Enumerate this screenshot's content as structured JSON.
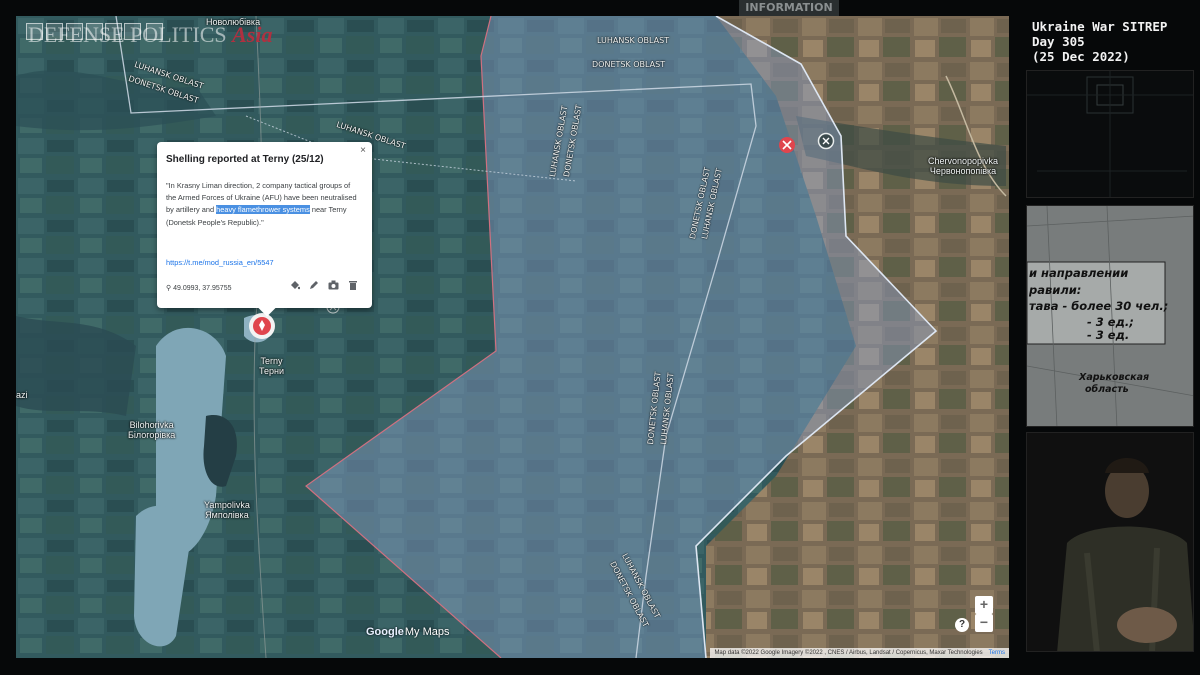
{
  "header": {
    "info_tag": "INFORMATION"
  },
  "logo": {
    "main": "Defense Politics",
    "accent": "Asia",
    "left_text": "DEFENSE POLITICS"
  },
  "sitrep": {
    "title": "Ukraine War SITREP",
    "day": "Day 305",
    "date": "(25 Dec 2022)"
  },
  "map": {
    "boundary_labels": {
      "l1_top": "LUHANSK OBLAST",
      "d1_top": "DONETSK OBLAST",
      "l_nw": "LUHANSK OBLAST",
      "d_nw": "DONETSK OBLAST",
      "l_mid": "LUHANSK OBLAST",
      "l_v1": "LUHANSK OBLAST",
      "d_v1": "DONETSK OBLAST",
      "d_v2": "DONETSK OBLAST",
      "l_v2": "LUHANSK OBLAST",
      "d_v3": "DONETSK OBLAST",
      "l_v3": "LUHANSK OBLAST",
      "l_v4": "LUHANSK OBLAST",
      "d_v4": "DONETSK OBLAST"
    },
    "places": {
      "novoliubivka": "Новолюбівка",
      "chervonopopivka_en": "Chervonopopivka",
      "chervonopopivka_ua": "Червонопопівка",
      "terny_en": "Terny",
      "terny_ua": "Терни",
      "bilohorivka_en": "Bilohorivka",
      "bilohorivka_ua": "Білогорівка",
      "yampolivka_en": "Yampolivka",
      "yampolivka_ua": "Ямполівка",
      "azi": "azi"
    },
    "popup": {
      "title": "Shelling reported at Terny (25/12)",
      "close": "×",
      "body_before": "\"In Krasny Liman direction, 2 company tactical groups of the Armed Forces of Ukraine (AFU) have been neutralised by artillery and ",
      "body_highlight": "heavy flamethrower systems",
      "body_after": " near Terny (Donetsk People's Republic).\"",
      "link": "https://t.me/mod_russia_en/5547",
      "coords": "49.0993, 37.95755",
      "tools": [
        "paint-bucket-icon",
        "pencil-icon",
        "camera-icon",
        "trash-icon"
      ]
    },
    "zoom_in": "+",
    "zoom_out": "−",
    "help": "?",
    "branding": {
      "google": "Google",
      "mymaps": "My Maps"
    },
    "attribution": "Map data ©2022 Google Imagery ©2022 , CNES / Airbus, Landsat / Copernicus, Maxar Technologies",
    "terms": "Terms",
    "colors": {
      "red_zone": "#c05060",
      "blue_zone": "#8aa0c8"
    }
  },
  "panel2": {
    "lines": [
      "и направлении",
      "равили:",
      "тава  - более 30 чел.;",
      "- 3 ед.;",
      "- 3 ед.",
      "Харьковская",
      "область"
    ]
  }
}
